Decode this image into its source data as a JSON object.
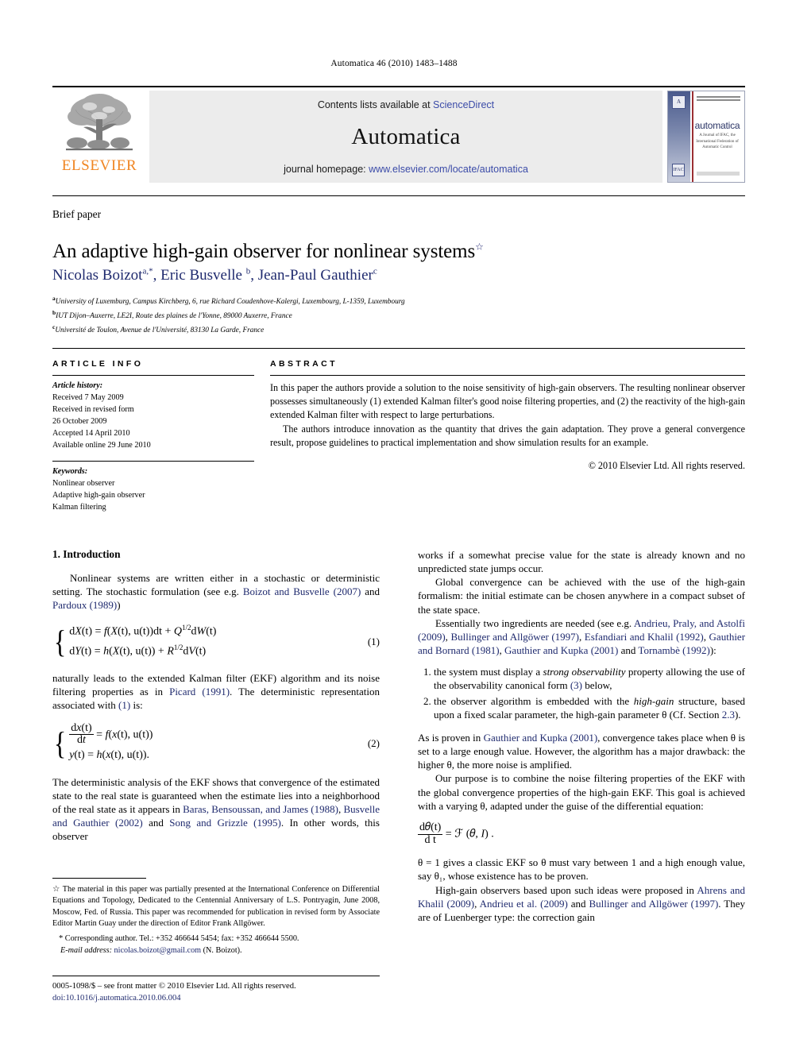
{
  "running_head": "Automatica 46 (2010) 1483–1488",
  "masthead": {
    "publisher_logo_label": "ELSEVIER",
    "contents_prefix": "Contents lists available at ",
    "contents_link": "ScienceDirect",
    "journal_name": "Automatica",
    "homepage_prefix": "journal homepage: ",
    "homepage_url": "www.elsevier.com/locate/automatica",
    "cover": {
      "title": "automatica",
      "subtitle": "A Journal of IFAC, the International Federation of Automatic Control",
      "badge": "A",
      "badge2": "IFAC"
    }
  },
  "article": {
    "type_label": "Brief paper",
    "title": "An adaptive high-gain observer for nonlinear systems",
    "title_marker": "☆",
    "authors_html": "Nicolas Boizot<sup>a,*</sup>, Eric Busvelle <sup>b</sup>, Jean-Paul Gauthier<sup>c</sup>",
    "affiliations": [
      {
        "marker": "a",
        "text": "University of Luxemburg, Campus Kirchberg, 6, rue Richard Coudenhove-Kalergi, Luxembourg, L-1359, Luxembourg"
      },
      {
        "marker": "b",
        "text": "IUT Dijon–Auxerre, LE2I, Route des plaines de l'Yonne, 89000 Auxerre, France"
      },
      {
        "marker": "c",
        "text": "Université de Toulon, Avenue de l'Université, 83130 La Garde, France"
      }
    ]
  },
  "article_info": {
    "heading": "ARTICLE INFO",
    "history_label": "Article history:",
    "history": [
      "Received 7 May 2009",
      "Received in revised form",
      "26 October 2009",
      "Accepted 14 April 2010",
      "Available online 29 June 2010"
    ],
    "keywords_label": "Keywords:",
    "keywords": [
      "Nonlinear observer",
      "Adaptive high-gain observer",
      "Kalman filtering"
    ]
  },
  "abstract": {
    "heading": "ABSTRACT",
    "paragraphs": [
      "In this paper the authors provide a solution to the noise sensitivity of high-gain observers. The resulting nonlinear observer possesses simultaneously (1) extended Kalman filter's good noise filtering properties, and (2) the reactivity of the high-gain extended Kalman filter with respect to large perturbations.",
      "The authors introduce innovation as the quantity that drives the gain adaptation. They prove a general convergence result, propose guidelines to practical implementation and show simulation results for an example."
    ],
    "copyright": "© 2010 Elsevier Ltd. All rights reserved."
  },
  "body": {
    "section_title": "1. Introduction",
    "left": {
      "p1_a": "Nonlinear systems are written either in a stochastic or deterministic setting. The stochastic formulation (see e.g. ",
      "p1_ref1": "Boizot and Busvelle (2007)",
      "p1_b": " and ",
      "p1_ref2": "Pardoux (1989)",
      "p1_c": ")",
      "eq1_line1": "dX(t) = f(X(t), u(t))dt + Q½dW(t)",
      "eq1_line2": "dY(t) = h(X(t), u(t)) + R½dV(t)",
      "eq1_num": "(1)",
      "p2_a": "naturally leads to the extended Kalman filter (EKF) algorithm and its noise filtering properties as in ",
      "p2_ref1": "Picard (1991)",
      "p2_b": ". The deterministic representation associated with ",
      "p2_ref2": "(1)",
      "p2_c": " is:",
      "eq2_line1": "dx(t)/dt = f(x(t), u(t))",
      "eq2_line2": "y(t) = h(x(t), u(t)).",
      "eq2_num": "(2)",
      "p3_a": "The deterministic analysis of the EKF shows that convergence of the estimated state to the real state is guaranteed when the estimate lies into a neighborhood of the real state as it appears in ",
      "p3_ref1": "Baras, Bensoussan, and James (1988)",
      "p3_b": ", ",
      "p3_ref2": "Busvelle and Gauthier (2002)",
      "p3_c": " and ",
      "p3_ref3": "Song and Grizzle (1995)",
      "p3_d": ". In other words, this observer"
    },
    "right": {
      "p1": "works if a somewhat precise value for the state is already known and no unpredicted state jumps occur.",
      "p2": "Global convergence can be achieved with the use of the high-gain formalism: the initial estimate can be chosen anywhere in a compact subset of the state space.",
      "p3_a": "Essentially two ingredients are needed (see e.g. ",
      "p3_ref1": "Andrieu, Praly, and Astolfi (2009)",
      "p3_b": ", ",
      "p3_ref2": "Bullinger and Allgöwer (1997)",
      "p3_c": ", ",
      "p3_ref3": "Esfandiari and Khalil (1992)",
      "p3_d": ", ",
      "p3_ref4": "Gauthier and Bornard (1981)",
      "p3_e": ", ",
      "p3_ref5": "Gauthier and Kupka (2001)",
      "p3_f": " and ",
      "p3_ref6": "Tornambè (1992)",
      "p3_g": "):",
      "item1_a": "the system must display a ",
      "item1_ital": "strong observability",
      "item1_b": " property allowing the use of the observability canonical form ",
      "item1_ref": "(3)",
      "item1_c": " below,",
      "item2_a": "the observer algorithm is embedded with the ",
      "item2_ital": "high-gain",
      "item2_b": " structure, based upon a fixed scalar parameter, the high-gain parameter θ (Cf. Section ",
      "item2_ref": "2.3",
      "item2_c": ").",
      "p4_a": "As is proven in ",
      "p4_ref": "Gauthier and Kupka (2001)",
      "p4_b": ", convergence takes place when θ is set to a large enough value. However, the algorithm has a major drawback: the higher θ, the more noise is amplified.",
      "p5": "Our purpose is to combine the noise filtering properties of the EKF with the global convergence properties of the high-gain EKF. This goal is achieved with a varying θ, adapted under the guise of the differential equation:",
      "eq3": "dθ(t)/dt = ℱ(θ, I).",
      "p6": "θ = 1 gives a classic EKF so θ must vary between 1 and a high enough value, say θ₁, whose existence has to be proven.",
      "p7_a": "High-gain observers based upon such ideas were proposed in ",
      "p7_ref1": "Ahrens and Khalil (2009)",
      "p7_b": ", ",
      "p7_ref2": "Andrieu et al. (2009)",
      "p7_c": " and ",
      "p7_ref3": "Bullinger and Allgöwer (1997)",
      "p7_d": ". They are of Luenberger type: the correction gain"
    }
  },
  "footnotes": {
    "star_marker": "☆",
    "star_text": "The material in this paper was partially presented at the International Conference on Differential Equations and Topology, Dedicated to the Centennial Anniversary of L.S. Pontryagin, June 2008, Moscow, Fed. of Russia. This paper was recommended for publication in revised form by Associate Editor Martin Guay under the direction of Editor Frank Allgöwer.",
    "corresponding_marker": "*",
    "corresponding_text": "Corresponding author. Tel.: +352 466644 5454; fax: +352 466644 5500.",
    "email_label": "E-mail address:",
    "email": "nicolas.boizot@gmail.com",
    "email_suffix": "(N. Boizot)."
  },
  "front_matter": {
    "line1": "0005-1098/$ – see front matter © 2010 Elsevier Ltd. All rights reserved.",
    "doi": "doi:10.1016/j.automatica.2010.06.004"
  },
  "colors": {
    "link": "#1f2a6e",
    "sciencedirect": "#3b4ba8",
    "elsevier_orange": "#F08522"
  }
}
